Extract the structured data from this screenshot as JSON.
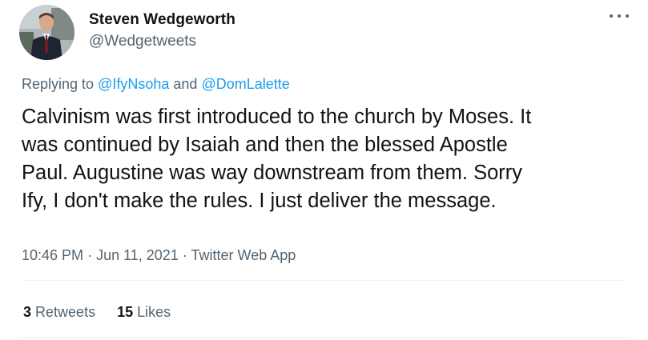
{
  "author": {
    "display_name": "Steven Wedgeworth",
    "handle": "@Wedgetweets"
  },
  "reply": {
    "prefix": "Replying to",
    "mention1": "@IfyNsoha",
    "joiner": "and",
    "mention2": "@DomLalette"
  },
  "tweet": {
    "lines": [
      "Calvinism was first introduced to the church by Moses. It",
      "was continued by Isaiah and then the blessed Apostle",
      "Paul. Augustine was way downstream from them. Sorry",
      "Ify, I don't make the rules. I just deliver the message."
    ]
  },
  "meta": {
    "time": "10:46 PM",
    "date": "Jun 11, 2021",
    "separator": "·",
    "source": "Twitter Web App"
  },
  "stats": {
    "retweets_count": "3",
    "retweets_label": "Retweets",
    "likes_count": "15",
    "likes_label": "Likes"
  },
  "icons": {
    "more": "more-horizontal-icon"
  },
  "colors": {
    "link": "#1d9bf0",
    "secondary_text": "#536471",
    "primary_text": "#0f1419",
    "divider": "#eff3f4"
  }
}
